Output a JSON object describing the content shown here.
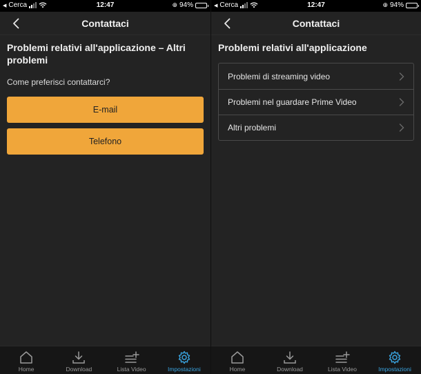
{
  "status_bar": {
    "carrier": "Cerca",
    "time": "12:47",
    "battery": "94%",
    "battery_level": 0.94
  },
  "left_screen": {
    "nav_title": "Contattaci",
    "section_title": "Problemi relativi all'applicazione – Altri problemi",
    "question": "Come preferisci contattarci?",
    "buttons": [
      {
        "label": "E-mail"
      },
      {
        "label": "Telefono"
      }
    ]
  },
  "right_screen": {
    "nav_title": "Contattaci",
    "section_title": "Problemi relativi all'applicazione",
    "items": [
      {
        "label": "Problemi di streaming video"
      },
      {
        "label": "Problemi nel guardare Prime Video"
      },
      {
        "label": "Altri problemi"
      }
    ]
  },
  "tab_bar": {
    "tabs": [
      {
        "label": "Home",
        "icon": "home-icon"
      },
      {
        "label": "Download",
        "icon": "download-icon"
      },
      {
        "label": "Lista Video",
        "icon": "watchlist-icon"
      },
      {
        "label": "Impostazioni",
        "icon": "gear-icon",
        "active": true
      }
    ]
  },
  "colors": {
    "accent": "#f0a63a",
    "active_tab": "#3aa4e0",
    "background": "#232323"
  }
}
